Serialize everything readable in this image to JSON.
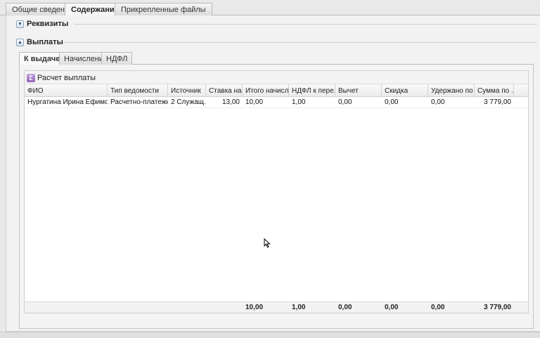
{
  "top_tabs": [
    {
      "label": "Общие сведения"
    },
    {
      "label": "Содержание"
    },
    {
      "label": "Прикрепленные файлы"
    }
  ],
  "sections": {
    "requisites": {
      "label": "Реквизиты",
      "state": "collapsed"
    },
    "payments": {
      "label": "Выплаты",
      "state": "expanded"
    }
  },
  "inner_tabs": [
    {
      "label": "К выдаче"
    },
    {
      "label": "Начисление"
    },
    {
      "label": "НДФЛ"
    }
  ],
  "toolbar": {
    "calc_button_label": "Расчет выплаты",
    "calc_icon_glyph": "Σ"
  },
  "columns": [
    "ФИО",
    "Тип ведомости",
    "Источник",
    "Ставка на...",
    "Итого начисл...",
    "НДФЛ к пере...",
    "Вычет",
    "Скидка",
    "Удержано по ...",
    "Сумма по ..."
  ],
  "rows": [
    {
      "cells": [
        "Нургатина Ирина Ефимовна",
        "Расчетно-платежная",
        "2 Служащ...",
        "13,00",
        "10,00",
        "1,00",
        "0,00",
        "0,00",
        "0,00",
        "3 779,00"
      ]
    }
  ],
  "totals": [
    "10,00",
    "1,00",
    "0,00",
    "0,00",
    "0,00",
    "3 779,00"
  ],
  "colors": {
    "accent": "#8e5fb8",
    "tab_border": "#b9b9b9"
  }
}
